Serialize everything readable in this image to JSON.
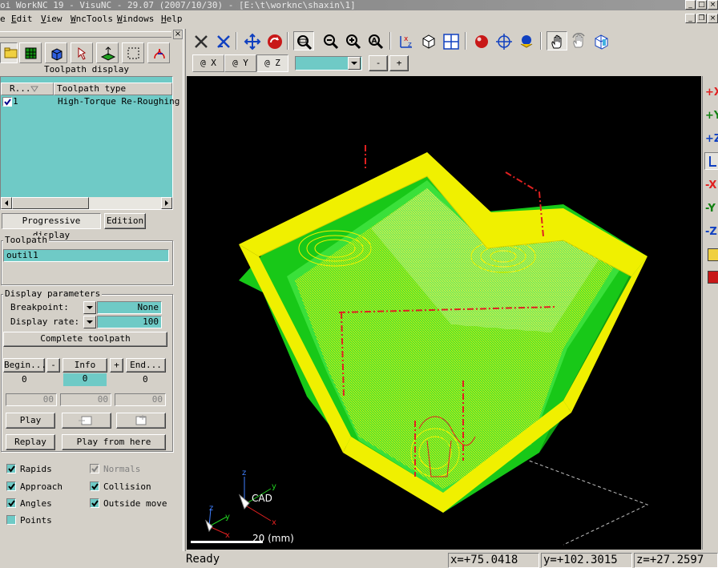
{
  "window": {
    "title": "oi WorkNC 19 - VisuNC - 29.07 (2007/10/30) - [E:\\t\\worknc\\shaxin\\1]"
  },
  "menu": {
    "items": [
      {
        "accel": "E",
        "rest": "dit"
      },
      {
        "accel": "V",
        "rest": "iew"
      },
      {
        "accel": "W",
        "rest": "ncTools"
      },
      {
        "accel": "W",
        "rest": "indows"
      },
      {
        "accel": "H",
        "rest": "elp"
      }
    ],
    "first_fragment": "e"
  },
  "left": {
    "panel_title": "Toolpath display",
    "columns": [
      "R...",
      "Toolpath type"
    ],
    "rows": [
      {
        "number": "1",
        "type": "High-Torque Re-Roughing",
        "checked": true
      }
    ],
    "progressive_display_label": "Progressive display",
    "edition_label": "Edition",
    "toolpath_group": "Toolpath",
    "toolpath_value": "outil1",
    "display_params_group": "Display parameters",
    "breakpoint_label": "Breakpoint:",
    "breakpoint_value": "None",
    "display_rate_label": "Display rate:",
    "display_rate_value": "100",
    "complete_toolpath_label": "Complete toolpath",
    "begin_label": "Begin...",
    "minus_label": "-",
    "info_label": "Info",
    "plus_label": "+",
    "end_label": "End...",
    "begin_value": "0",
    "info_value": "0",
    "end_value": "0",
    "time_1": "00",
    "time_2": "00",
    "time_3": "00",
    "play_label": "Play",
    "replay_label": "Replay",
    "play_from_here_label": "Play from here",
    "checkboxes": [
      {
        "label": "Rapids",
        "checked": true,
        "enabled": true
      },
      {
        "label": "Normals",
        "checked": true,
        "enabled": false
      },
      {
        "label": "Approach",
        "checked": true,
        "enabled": true
      },
      {
        "label": "Collision",
        "checked": true,
        "enabled": true
      },
      {
        "label": "Angles",
        "checked": true,
        "enabled": true
      },
      {
        "label": "Outside move",
        "checked": true,
        "enabled": true
      },
      {
        "label": "Points",
        "checked": false,
        "enabled": true
      }
    ]
  },
  "view_tabs": [
    "@ X",
    "@ Y",
    "@ Z"
  ],
  "view_minus": "-",
  "view_plus": "+",
  "viewport": {
    "cad_label": "CAD",
    "scale_label": "20 (mm)",
    "axis_z": "z",
    "axis_y": "y",
    "axis_x": "x"
  },
  "right_toolbar": [
    "+X",
    "+Y",
    "+Z",
    "-X",
    "-Y",
    "-Z"
  ],
  "status": {
    "ready": "Ready",
    "x": "x=+75.0418",
    "y": "y=+102.3015",
    "z": "z=+27.2597"
  },
  "colors": {
    "teal": "#6fcac6",
    "model_green": "#22cc22",
    "toolpath_yellow": "#f0f000",
    "toolpath_red": "#e02020"
  }
}
